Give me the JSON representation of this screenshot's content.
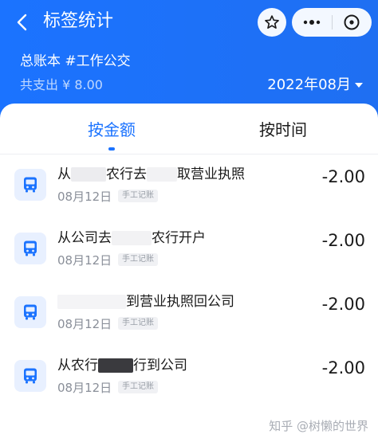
{
  "header": {
    "title": "标签统计",
    "book_name": "总账本 #工作公交",
    "total_label": "共支出 ¥ 8.00",
    "month": "2022年08月"
  },
  "icons": {
    "back": "chevron-left-icon",
    "favorite": "star-icon",
    "more": "more-dots-icon",
    "close": "close-circle-icon",
    "month_dropdown": "triangle-down-icon",
    "category": "bus-icon"
  },
  "tabs": [
    {
      "label": "按金额",
      "active": true
    },
    {
      "label": "按时间",
      "active": false
    }
  ],
  "records": [
    {
      "desc_a": "从",
      "desc_b": "农行去",
      "desc_c": "取营业执照",
      "date": "08月12日",
      "tag": "手工记账",
      "amount": "-2.00"
    },
    {
      "desc_a": "从公司去",
      "desc_b": "农行开户",
      "desc_c": "",
      "date": "08月12日",
      "tag": "手工记账",
      "amount": "-2.00"
    },
    {
      "desc_a": "",
      "desc_b": "到营业执照回公司",
      "desc_c": "",
      "date": "08月12日",
      "tag": "手工记账",
      "amount": "-2.00"
    },
    {
      "desc_a": "从农行",
      "desc_b": "行到公司",
      "desc_c": "",
      "date": "08月12日",
      "tag": "手工记账",
      "amount": "-2.00"
    }
  ],
  "watermark": "知乎 @树懒的世界",
  "colors": {
    "primary": "#1b73ff",
    "icon_bg": "#e8f0ff"
  }
}
